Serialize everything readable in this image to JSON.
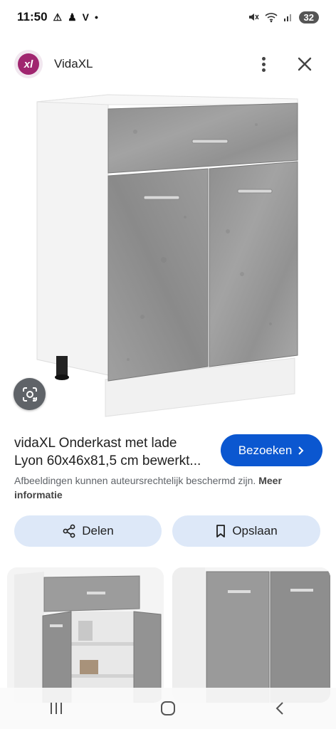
{
  "status_bar": {
    "time": "11:50",
    "battery": "32"
  },
  "header": {
    "site_name": "VidaXL",
    "logo_text": "xl"
  },
  "product": {
    "title_line1": "vidaXL Onderkast met lade",
    "title_line2": "Lyon 60x46x81,5 cm bewerkt...",
    "visit_label": "Bezoeken",
    "copyright_text": "Afbeeldingen kunnen auteursrechtelijk beschermd zijn.",
    "more_info_label": "Meer informatie"
  },
  "actions": {
    "share_label": "Delen",
    "save_label": "Opslaan"
  },
  "colors": {
    "accent": "#0b57d0",
    "pill_bg": "#dde8f8",
    "brand": "#a0256f",
    "concrete": "#9a9a9a"
  },
  "icons": [
    "mute-icon",
    "wifi-icon",
    "signal-icon",
    "more-vert-icon",
    "close-icon",
    "lens-icon",
    "share-icon",
    "bookmark-icon",
    "chevron-right-icon",
    "recents-icon",
    "home-icon",
    "back-icon"
  ]
}
